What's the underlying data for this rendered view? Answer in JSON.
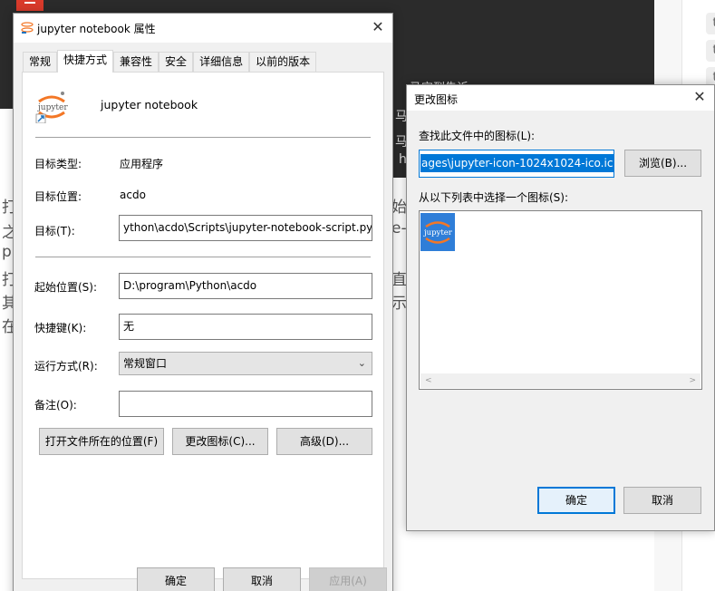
{
  "background": {
    "article_fragments": [
      "打",
      "之",
      "p",
      "打",
      "其",
      "在",
      "始",
      "e-",
      "直",
      "示,"
    ],
    "dark_fragments": [
      "马定到告诉",
      "马",
      "马",
      "h"
    ],
    "side_chips": [
      "t",
      "t",
      "t",
      "t",
      "t"
    ]
  },
  "properties_dialog": {
    "title": "jupyter notebook 属性",
    "close_glyph": "✕",
    "tabs": [
      "常规",
      "快捷方式",
      "兼容性",
      "安全",
      "详细信息",
      "以前的版本"
    ],
    "active_tab": "快捷方式",
    "app_name": "jupyter notebook",
    "target_type_label": "目标类型:",
    "target_type_value": "应用程序",
    "target_location_label": "目标位置:",
    "target_location_value": "acdo",
    "target_label": "目标(T):",
    "target_value": "ython\\acdo\\Scripts\\jupyter-notebook-script.py",
    "start_in_label": "起始位置(S):",
    "start_in_value": "D:\\program\\Python\\acdo",
    "shortcut_key_label": "快捷键(K):",
    "shortcut_key_value": "无",
    "run_label": "运行方式(R):",
    "run_value": "常规窗口",
    "comment_label": "备注(O):",
    "comment_value": "",
    "open_location_button": "打开文件所在的位置(F)",
    "change_icon_button": "更改图标(C)...",
    "advanced_button": "高级(D)...",
    "ok_button": "确定",
    "cancel_button": "取消",
    "apply_button": "应用(A)"
  },
  "change_icon_dialog": {
    "title": "更改图标",
    "close_glyph": "✕",
    "find_label": "查找此文件中的图标(L):",
    "file_value": "ages\\jupyter-icon-1024x1024-ico.ico",
    "browse_button": "浏览(B)...",
    "list_label": "从以下列表中选择一个图标(S):",
    "icon_caption": "jupyter",
    "scroll_left": "<",
    "scroll_right": ">",
    "ok_button": "确定",
    "cancel_button": "取消"
  }
}
